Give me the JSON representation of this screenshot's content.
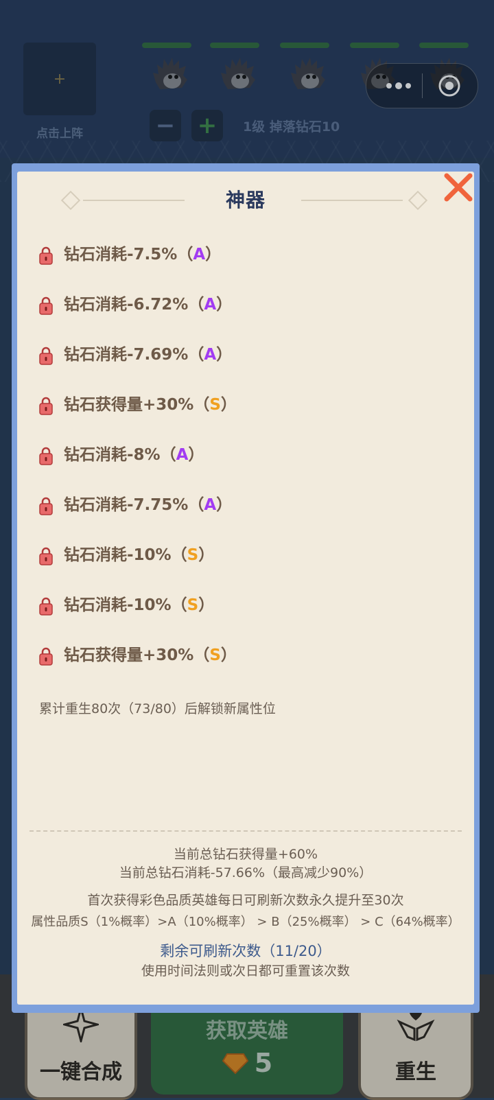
{
  "scene": {
    "slot_caption": "点击上阵",
    "slot_plus": "+",
    "minus_label": "−",
    "plus_label": "+",
    "level_text": "1级 掉落钻石10",
    "hero_count": 5
  },
  "bottom": {
    "left_label": "一键合成",
    "center_title": "获取英雄",
    "center_cost": "5",
    "right_label": "重生"
  },
  "modal": {
    "title": "神器",
    "attributes": [
      {
        "text": "钻石消耗-7.5%",
        "grade": "A"
      },
      {
        "text": "钻石消耗-6.72%",
        "grade": "A"
      },
      {
        "text": "钻石消耗-7.69%",
        "grade": "A"
      },
      {
        "text": "钻石获得量+30%",
        "grade": "S"
      },
      {
        "text": "钻石消耗-8%",
        "grade": "A"
      },
      {
        "text": "钻石消耗-7.75%",
        "grade": "A"
      },
      {
        "text": "钻石消耗-10%",
        "grade": "S"
      },
      {
        "text": "钻石消耗-10%",
        "grade": "S"
      },
      {
        "text": "钻石获得量+30%",
        "grade": "S"
      }
    ],
    "unlock_note": "累计重生80次（73/80）后解锁新属性位",
    "total_gain": "当前总钻石获得量+60%",
    "total_cost": "当前总钻石消耗-57.66%（最高减少90%）",
    "first_rainbow": "首次获得彩色品质英雄每日可刷新次数永久提升至30次",
    "quality_odds": "属性品质S（1%概率）>A（10%概率） > B（25%概率） > C（64%概率）",
    "refresh_left": "剩余可刷新次数（11/20）",
    "reset_hint": "使用时间法则或次日都可重置该次数"
  },
  "colors": {
    "grade_A": "#a23cf2",
    "grade_S": "#f0a020",
    "modal_border": "#7da0dc",
    "modal_bg": "#f2ebdd",
    "title": "#2b3a5e",
    "close": "#f0643c"
  }
}
